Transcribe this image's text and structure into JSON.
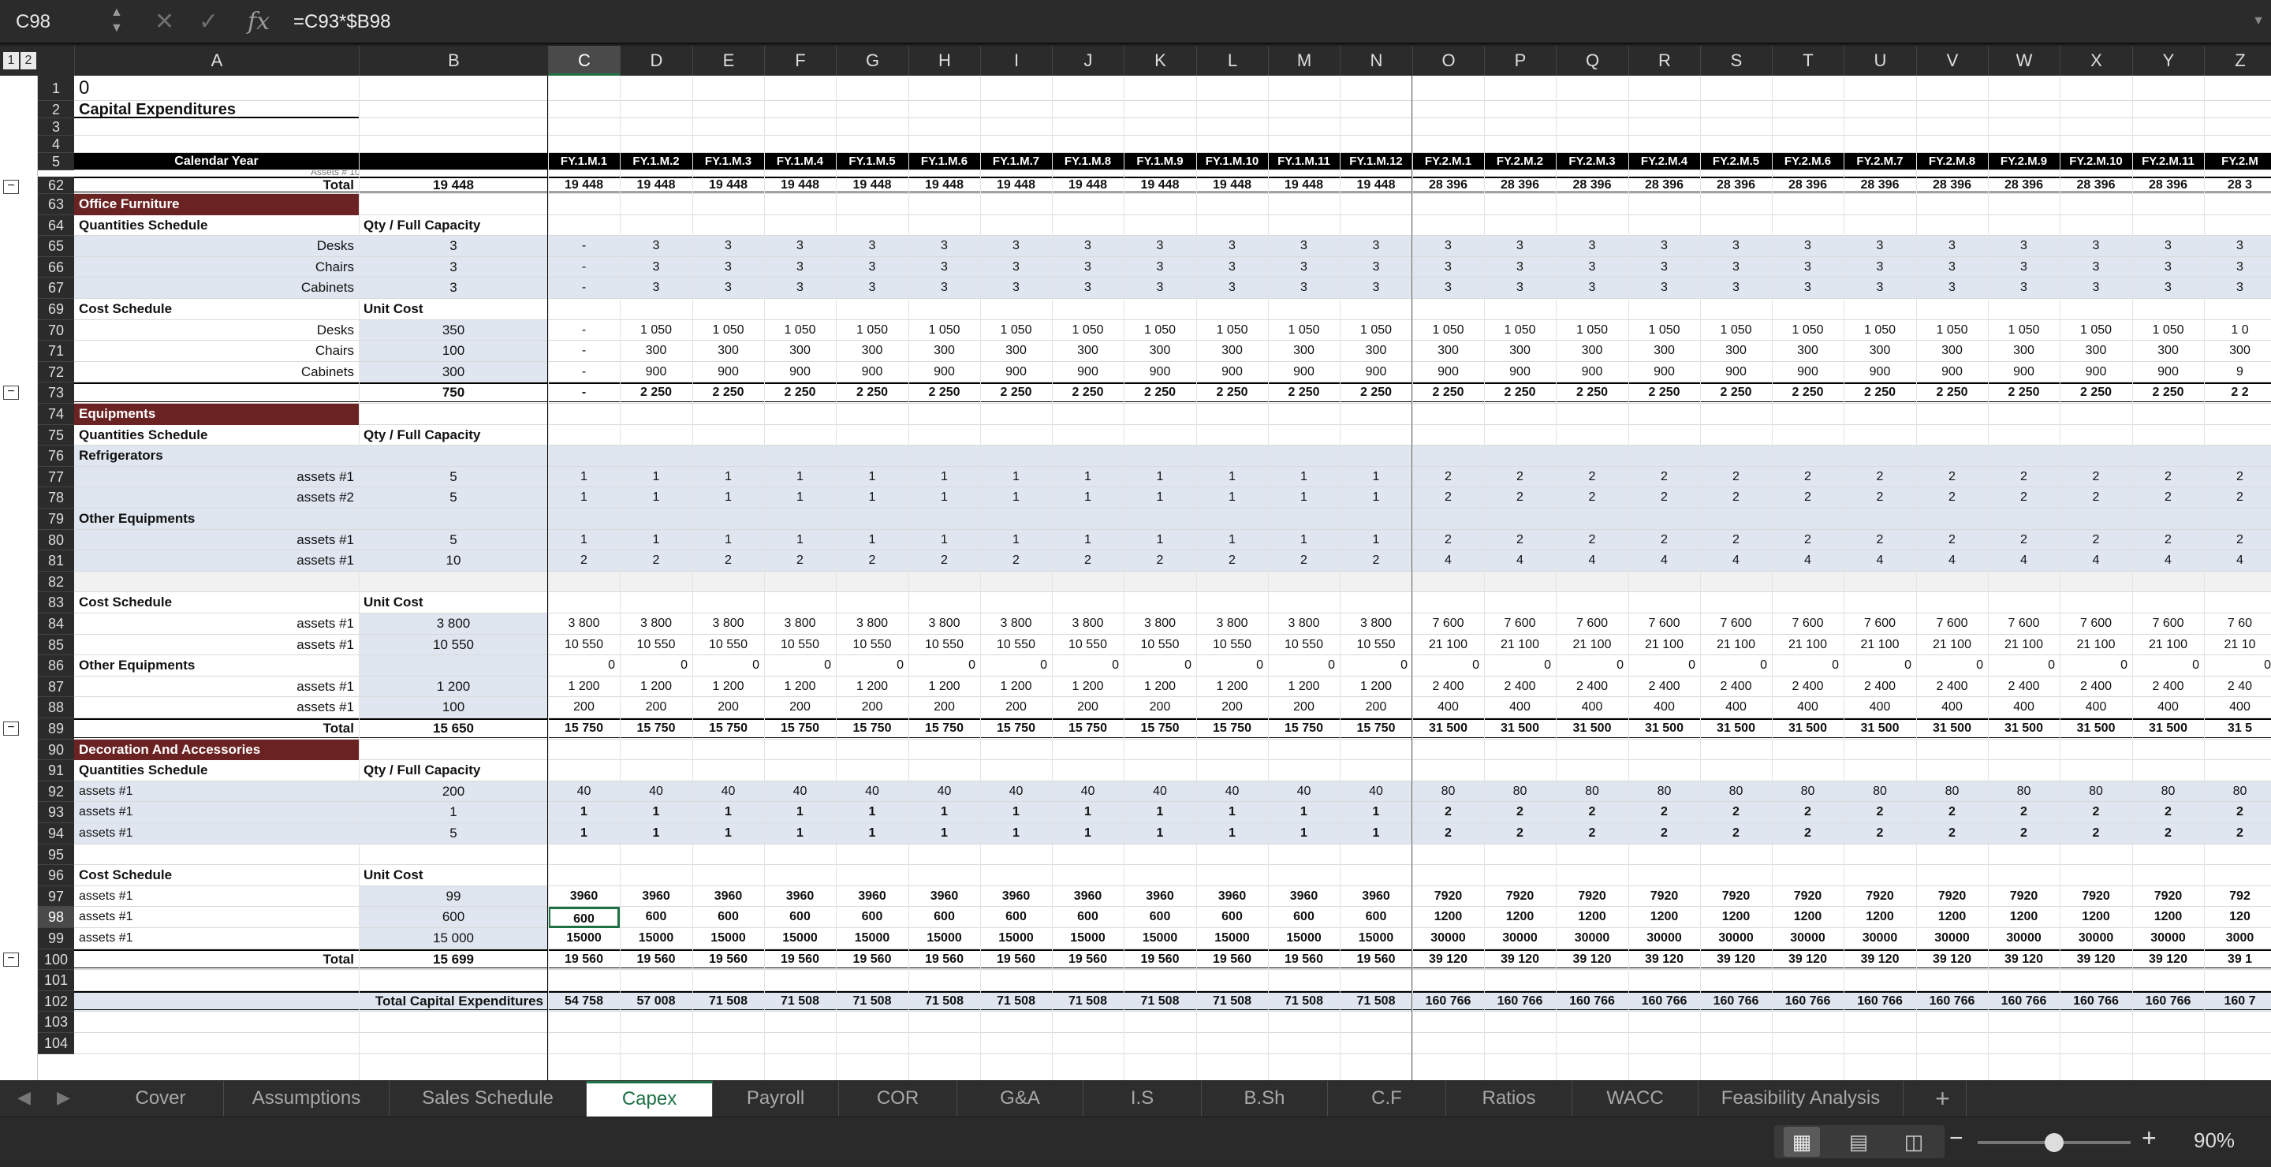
{
  "formula_bar": {
    "name_box": "C98",
    "fx": "fx",
    "formula": "=C93*$B98"
  },
  "outline_levels": [
    "1",
    "2"
  ],
  "columns": [
    "A",
    "B",
    "C",
    "D",
    "E",
    "F",
    "G",
    "H",
    "I",
    "J",
    "K",
    "L",
    "M",
    "N",
    "O",
    "P",
    "Q",
    "R",
    "S",
    "T",
    "U",
    "V",
    "W",
    "X",
    "Y",
    "Z"
  ],
  "selected_col": "C",
  "rows": [
    {
      "n": "1",
      "a": "0",
      "cls": "title0",
      "fill": "none"
    },
    {
      "n": "2",
      "a": "Capital Expenditures",
      "cls": "title",
      "fill": "none"
    },
    {
      "n": "3",
      "fill": "none"
    },
    {
      "n": "4",
      "fill": "none"
    },
    {
      "n": "5",
      "a": "Calendar Year",
      "cls": "calhdr",
      "fill": "hdrs"
    },
    {
      "n": "62",
      "b": "19 448",
      "a": "Total",
      "cls": "totalr",
      "fill": "tot",
      "v": [
        "19 448",
        "19 448",
        "19 448",
        "19 448",
        "19 448",
        "19 448",
        "19 448",
        "19 448",
        "19 448",
        "19 448",
        "19 448",
        "19 448",
        "28 396",
        "28 396",
        "28 396",
        "28 396",
        "28 396",
        "28 396",
        "28 396",
        "28 396",
        "28 396",
        "28 396",
        "28 396",
        "28 3"
      ]
    },
    {
      "n": "63",
      "a": "Office Furniture",
      "cls": "section",
      "fill": "none"
    },
    {
      "n": "64",
      "a": "Quantities Schedule",
      "b": "Qty / Full Capacity",
      "cls": "subhdr",
      "fill": "none"
    },
    {
      "n": "65",
      "a": "Desks",
      "b": "3",
      "cls": "itemr",
      "fill": "blue",
      "v": [
        "-",
        "3",
        "3",
        "3",
        "3",
        "3",
        "3",
        "3",
        "3",
        "3",
        "3",
        "3",
        "3",
        "3",
        "3",
        "3",
        "3",
        "3",
        "3",
        "3",
        "3",
        "3",
        "3",
        "3"
      ]
    },
    {
      "n": "66",
      "a": "Chairs",
      "b": "3",
      "cls": "itemr",
      "fill": "blue",
      "v": [
        "-",
        "3",
        "3",
        "3",
        "3",
        "3",
        "3",
        "3",
        "3",
        "3",
        "3",
        "3",
        "3",
        "3",
        "3",
        "3",
        "3",
        "3",
        "3",
        "3",
        "3",
        "3",
        "3",
        "3"
      ]
    },
    {
      "n": "67",
      "a": "Cabinets",
      "b": "3",
      "cls": "itemr",
      "fill": "blue",
      "v": [
        "-",
        "3",
        "3",
        "3",
        "3",
        "3",
        "3",
        "3",
        "3",
        "3",
        "3",
        "3",
        "3",
        "3",
        "3",
        "3",
        "3",
        "3",
        "3",
        "3",
        "3",
        "3",
        "3",
        "3"
      ]
    },
    {
      "n": "69",
      "a": "Cost Schedule",
      "b": "Unit Cost",
      "cls": "subhdr",
      "fill": "none"
    },
    {
      "n": "70",
      "a": "Desks",
      "b": "350",
      "cls": "itemr",
      "fill": "b-only",
      "v": [
        "-",
        "1 050",
        "1 050",
        "1 050",
        "1 050",
        "1 050",
        "1 050",
        "1 050",
        "1 050",
        "1 050",
        "1 050",
        "1 050",
        "1 050",
        "1 050",
        "1 050",
        "1 050",
        "1 050",
        "1 050",
        "1 050",
        "1 050",
        "1 050",
        "1 050",
        "1 050",
        "1 0"
      ]
    },
    {
      "n": "71",
      "a": "Chairs",
      "b": "100",
      "cls": "itemr",
      "fill": "b-only",
      "v": [
        "-",
        "300",
        "300",
        "300",
        "300",
        "300",
        "300",
        "300",
        "300",
        "300",
        "300",
        "300",
        "300",
        "300",
        "300",
        "300",
        "300",
        "300",
        "300",
        "300",
        "300",
        "300",
        "300",
        "300"
      ]
    },
    {
      "n": "72",
      "a": "Cabinets",
      "b": "300",
      "cls": "itemr",
      "fill": "b-only",
      "v": [
        "-",
        "900",
        "900",
        "900",
        "900",
        "900",
        "900",
        "900",
        "900",
        "900",
        "900",
        "900",
        "900",
        "900",
        "900",
        "900",
        "900",
        "900",
        "900",
        "900",
        "900",
        "900",
        "900",
        "9"
      ]
    },
    {
      "n": "73",
      "b": "750",
      "cls": "totalr",
      "fill": "tot",
      "v": [
        "-",
        "2 250",
        "2 250",
        "2 250",
        "2 250",
        "2 250",
        "2 250",
        "2 250",
        "2 250",
        "2 250",
        "2 250",
        "2 250",
        "2 250",
        "2 250",
        "2 250",
        "2 250",
        "2 250",
        "2 250",
        "2 250",
        "2 250",
        "2 250",
        "2 250",
        "2 250",
        "2 2"
      ]
    },
    {
      "n": "74",
      "a": "Equipments",
      "cls": "section",
      "fill": "none"
    },
    {
      "n": "75",
      "a": "Quantities Schedule",
      "b": "Qty / Full Capacity",
      "cls": "subhdr",
      "fill": "none"
    },
    {
      "n": "76",
      "a": "Refrigerators",
      "cls": "subhdr",
      "fill": "blue"
    },
    {
      "n": "77",
      "a": "assets #1",
      "b": "5",
      "cls": "itemr",
      "fill": "blue",
      "v": [
        "1",
        "1",
        "1",
        "1",
        "1",
        "1",
        "1",
        "1",
        "1",
        "1",
        "1",
        "1",
        "2",
        "2",
        "2",
        "2",
        "2",
        "2",
        "2",
        "2",
        "2",
        "2",
        "2",
        "2"
      ]
    },
    {
      "n": "78",
      "a": "assets #2",
      "b": "5",
      "cls": "itemr",
      "fill": "blue",
      "v": [
        "1",
        "1",
        "1",
        "1",
        "1",
        "1",
        "1",
        "1",
        "1",
        "1",
        "1",
        "1",
        "2",
        "2",
        "2",
        "2",
        "2",
        "2",
        "2",
        "2",
        "2",
        "2",
        "2",
        "2"
      ]
    },
    {
      "n": "79",
      "a": "Other Equipments",
      "cls": "subhdr",
      "fill": "blue"
    },
    {
      "n": "80",
      "a": "assets #1",
      "b": "5",
      "cls": "itemr",
      "fill": "blue",
      "v": [
        "1",
        "1",
        "1",
        "1",
        "1",
        "1",
        "1",
        "1",
        "1",
        "1",
        "1",
        "1",
        "2",
        "2",
        "2",
        "2",
        "2",
        "2",
        "2",
        "2",
        "2",
        "2",
        "2",
        "2"
      ]
    },
    {
      "n": "81",
      "a": "assets #1",
      "b": "10",
      "cls": "itemr",
      "fill": "blue",
      "v": [
        "2",
        "2",
        "2",
        "2",
        "2",
        "2",
        "2",
        "2",
        "2",
        "2",
        "2",
        "2",
        "4",
        "4",
        "4",
        "4",
        "4",
        "4",
        "4",
        "4",
        "4",
        "4",
        "4",
        "4"
      ]
    },
    {
      "n": "82",
      "fill": "lightgrey"
    },
    {
      "n": "83",
      "a": "Cost Schedule",
      "b": "Unit Cost",
      "cls": "subhdr",
      "fill": "none"
    },
    {
      "n": "84",
      "a": "assets #1",
      "b": "3 800",
      "cls": "itemr",
      "fill": "b-only",
      "v": [
        "3 800",
        "3 800",
        "3 800",
        "3 800",
        "3 800",
        "3 800",
        "3 800",
        "3 800",
        "3 800",
        "3 800",
        "3 800",
        "3 800",
        "7 600",
        "7 600",
        "7 600",
        "7 600",
        "7 600",
        "7 600",
        "7 600",
        "7 600",
        "7 600",
        "7 600",
        "7 600",
        "7 60"
      ]
    },
    {
      "n": "85",
      "a": "assets #1",
      "b": "10 550",
      "cls": "itemr",
      "fill": "b-only",
      "v": [
        "10 550",
        "10 550",
        "10 550",
        "10 550",
        "10 550",
        "10 550",
        "10 550",
        "10 550",
        "10 550",
        "10 550",
        "10 550",
        "10 550",
        "21 100",
        "21 100",
        "21 100",
        "21 100",
        "21 100",
        "21 100",
        "21 100",
        "21 100",
        "21 100",
        "21 100",
        "21 100",
        "21 10"
      ]
    },
    {
      "n": "86",
      "a": "Other Equipments",
      "cls": "subhdr",
      "fill": "b-only",
      "v": [
        "0",
        "0",
        "0",
        "0",
        "0",
        "0",
        "0",
        "0",
        "0",
        "0",
        "0",
        "0",
        "0",
        "0",
        "0",
        "0",
        "0",
        "0",
        "0",
        "0",
        "0",
        "0",
        "0",
        "0"
      ]
    },
    {
      "n": "87",
      "a": "assets #1",
      "b": "1 200",
      "cls": "itemr",
      "fill": "b-only",
      "v": [
        "1 200",
        "1 200",
        "1 200",
        "1 200",
        "1 200",
        "1 200",
        "1 200",
        "1 200",
        "1 200",
        "1 200",
        "1 200",
        "1 200",
        "2 400",
        "2 400",
        "2 400",
        "2 400",
        "2 400",
        "2 400",
        "2 400",
        "2 400",
        "2 400",
        "2 400",
        "2 400",
        "2 40"
      ]
    },
    {
      "n": "88",
      "a": "assets #1",
      "b": "100",
      "cls": "itemr",
      "fill": "b-only",
      "v": [
        "200",
        "200",
        "200",
        "200",
        "200",
        "200",
        "200",
        "200",
        "200",
        "200",
        "200",
        "200",
        "400",
        "400",
        "400",
        "400",
        "400",
        "400",
        "400",
        "400",
        "400",
        "400",
        "400",
        "400"
      ]
    },
    {
      "n": "89",
      "a": "Total",
      "b": "15 650",
      "cls": "totalr",
      "fill": "tot",
      "v": [
        "15 750",
        "15 750",
        "15 750",
        "15 750",
        "15 750",
        "15 750",
        "15 750",
        "15 750",
        "15 750",
        "15 750",
        "15 750",
        "15 750",
        "31 500",
        "31 500",
        "31 500",
        "31 500",
        "31 500",
        "31 500",
        "31 500",
        "31 500",
        "31 500",
        "31 500",
        "31 500",
        "31 5"
      ]
    },
    {
      "n": "90",
      "a": "Decoration And Accessories",
      "cls": "section",
      "fill": "none"
    },
    {
      "n": "91",
      "a": "Quantities Schedule",
      "b": "Qty / Full Capacity",
      "cls": "subhdr",
      "fill": "none"
    },
    {
      "n": "92",
      "a": "assets #1",
      "b": "200",
      "cls": "iteml",
      "fill": "blue",
      "v": [
        "40",
        "40",
        "40",
        "40",
        "40",
        "40",
        "40",
        "40",
        "40",
        "40",
        "40",
        "40",
        "80",
        "80",
        "80",
        "80",
        "80",
        "80",
        "80",
        "80",
        "80",
        "80",
        "80",
        "80"
      ]
    },
    {
      "n": "93",
      "a": "assets #1",
      "b": "1",
      "cls": "iteml",
      "fill": "blue",
      "bold": true,
      "v": [
        "1",
        "1",
        "1",
        "1",
        "1",
        "1",
        "1",
        "1",
        "1",
        "1",
        "1",
        "1",
        "2",
        "2",
        "2",
        "2",
        "2",
        "2",
        "2",
        "2",
        "2",
        "2",
        "2",
        "2"
      ]
    },
    {
      "n": "94",
      "a": "assets #1",
      "b": "5",
      "cls": "iteml",
      "fill": "blue",
      "bold": true,
      "v": [
        "1",
        "1",
        "1",
        "1",
        "1",
        "1",
        "1",
        "1",
        "1",
        "1",
        "1",
        "1",
        "2",
        "2",
        "2",
        "2",
        "2",
        "2",
        "2",
        "2",
        "2",
        "2",
        "2",
        "2"
      ]
    },
    {
      "n": "95",
      "fill": "none"
    },
    {
      "n": "96",
      "a": "Cost Schedule",
      "b": "Unit Cost",
      "cls": "subhdr",
      "fill": "none"
    },
    {
      "n": "97",
      "a": "assets #1",
      "b": "99",
      "cls": "iteml",
      "fill": "b-only",
      "bold": true,
      "v": [
        "3960",
        "3960",
        "3960",
        "3960",
        "3960",
        "3960",
        "3960",
        "3960",
        "3960",
        "3960",
        "3960",
        "3960",
        "7920",
        "7920",
        "7920",
        "7920",
        "7920",
        "7920",
        "7920",
        "7920",
        "7920",
        "7920",
        "7920",
        "792"
      ]
    },
    {
      "n": "98",
      "a": "assets #1",
      "b": "600",
      "cls": "iteml",
      "fill": "b-only",
      "bold": true,
      "v": [
        "600",
        "600",
        "600",
        "600",
        "600",
        "600",
        "600",
        "600",
        "600",
        "600",
        "600",
        "600",
        "1200",
        "1200",
        "1200",
        "1200",
        "1200",
        "1200",
        "1200",
        "1200",
        "1200",
        "1200",
        "1200",
        "120"
      ]
    },
    {
      "n": "99",
      "a": "assets #1",
      "b": "15 000",
      "cls": "iteml",
      "fill": "b-only",
      "bold": true,
      "v": [
        "15000",
        "15000",
        "15000",
        "15000",
        "15000",
        "15000",
        "15000",
        "15000",
        "15000",
        "15000",
        "15000",
        "15000",
        "30000",
        "30000",
        "30000",
        "30000",
        "30000",
        "30000",
        "30000",
        "30000",
        "30000",
        "30000",
        "30000",
        "3000"
      ]
    },
    {
      "n": "100",
      "a": "Total",
      "b": "15 699",
      "cls": "totalr",
      "fill": "tot",
      "v": [
        "19 560",
        "19 560",
        "19 560",
        "19 560",
        "19 560",
        "19 560",
        "19 560",
        "19 560",
        "19 560",
        "19 560",
        "19 560",
        "19 560",
        "39 120",
        "39 120",
        "39 120",
        "39 120",
        "39 120",
        "39 120",
        "39 120",
        "39 120",
        "39 120",
        "39 120",
        "39 120",
        "39 1"
      ]
    },
    {
      "n": "101",
      "fill": "none"
    },
    {
      "n": "102",
      "b": "Total Capital Expenditures",
      "cls": "grand",
      "fill": "grand",
      "v": [
        "54 758",
        "57 008",
        "71 508",
        "71 508",
        "71 508",
        "71 508",
        "71 508",
        "71 508",
        "71 508",
        "71 508",
        "71 508",
        "71 508",
        "160 766",
        "160 766",
        "160 766",
        "160 766",
        "160 766",
        "160 766",
        "160 766",
        "160 766",
        "160 766",
        "160 766",
        "160 766",
        "160 7"
      ]
    },
    {
      "n": "103",
      "fill": "none"
    },
    {
      "n": "104",
      "fill": "none"
    }
  ],
  "period_headers": [
    "FY.1.M.1",
    "FY.1.M.2",
    "FY.1.M.3",
    "FY.1.M.4",
    "FY.1.M.5",
    "FY.1.M.6",
    "FY.1.M.7",
    "FY.1.M.8",
    "FY.1.M.9",
    "FY.1.M.10",
    "FY.1.M.11",
    "FY.1.M.12",
    "FY.2.M.1",
    "FY.2.M.2",
    "FY.2.M.3",
    "FY.2.M.4",
    "FY.2.M.5",
    "FY.2.M.6",
    "FY.2.M.7",
    "FY.2.M.8",
    "FY.2.M.9",
    "FY.2.M.10",
    "FY.2.M.11",
    "FY.2.M"
  ],
  "peek_label": "Assets # 10",
  "tabs": [
    "Cover",
    "Assumptions",
    "Sales Schedule",
    "Capex",
    "Payroll",
    "COR",
    "G&A",
    "I.S",
    "B.Sh",
    "C.F",
    "Ratios",
    "WACC",
    "Feasibility Analysis"
  ],
  "active_tab": "Capex",
  "add_sheet": "+",
  "zoom": {
    "label": "90%",
    "minus": "−",
    "plus": "+",
    "level": 0.5
  },
  "colors": {
    "section": "#6b2222",
    "blue_fill": "#dfe6f0",
    "header_black": "#000000",
    "grid": "#d9d9d9",
    "selection": "#1e7145"
  }
}
